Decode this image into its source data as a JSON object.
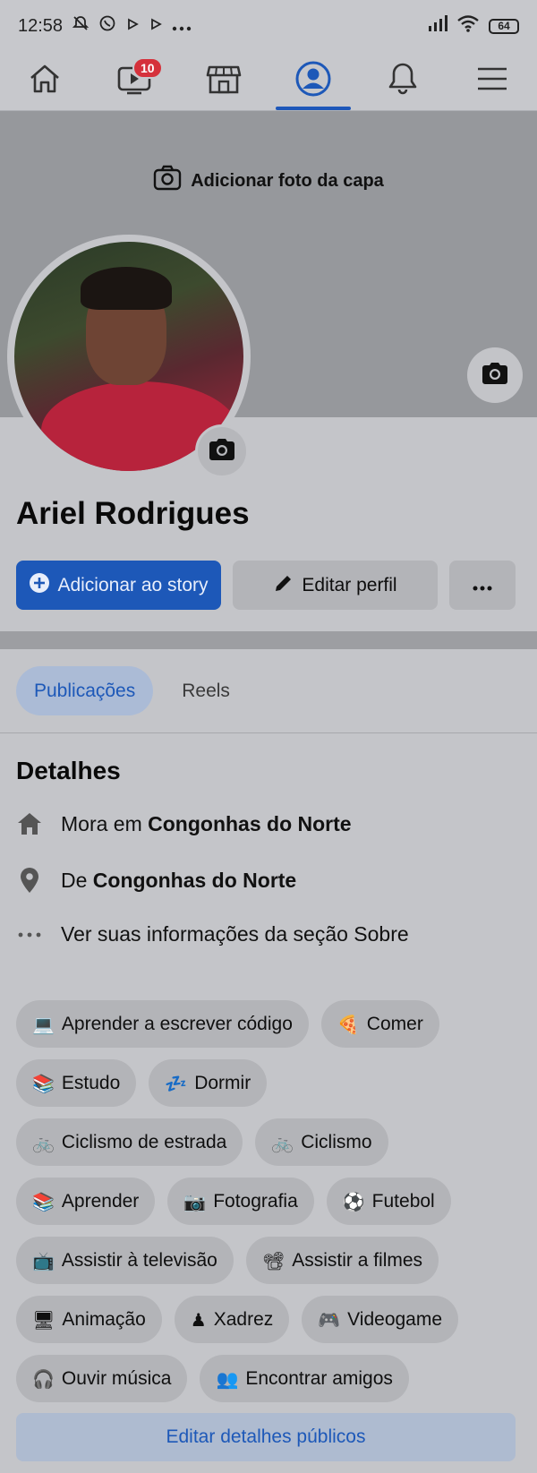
{
  "status_bar": {
    "time": "12:58",
    "battery": "64"
  },
  "nav": {
    "video_badge": "10"
  },
  "cover": {
    "add_cover_label": "Adicionar foto da capa"
  },
  "profile": {
    "name": "Ariel Rodrigues"
  },
  "actions": {
    "add_story_label": "Adicionar ao story",
    "edit_profile_label": "Editar perfil",
    "more_label": "•••"
  },
  "tabs": [
    {
      "label": "Publicações",
      "active": true
    },
    {
      "label": "Reels",
      "active": false
    }
  ],
  "details": {
    "title": "Detalhes",
    "lives_prefix": "Mora em ",
    "lives_city": "Congonhas do Norte",
    "from_prefix": "De ",
    "from_city": "Congonhas do Norte",
    "about_link": "Ver suas informações da seção Sobre"
  },
  "hobbies": [
    {
      "emoji": "💻",
      "label": "Aprender a escrever código"
    },
    {
      "emoji": "🍕",
      "label": "Comer"
    },
    {
      "emoji": "📚",
      "label": "Estudo"
    },
    {
      "emoji": "💤",
      "label": "Dormir"
    },
    {
      "emoji": "🚲",
      "label": "Ciclismo de estrada"
    },
    {
      "emoji": "🚲",
      "label": "Ciclismo"
    },
    {
      "emoji": "📚",
      "label": "Aprender"
    },
    {
      "emoji": "📷",
      "label": "Fotografia"
    },
    {
      "emoji": "⚽",
      "label": "Futebol"
    },
    {
      "emoji": "📺",
      "label": "Assistir à televisão"
    },
    {
      "emoji": "📽",
      "label": "Assistir a filmes"
    },
    {
      "emoji": "🖥",
      "label": "Animação"
    },
    {
      "emoji": "♟",
      "label": "Xadrez"
    },
    {
      "emoji": "🎮",
      "label": "Videogame"
    },
    {
      "emoji": "🎧",
      "label": "Ouvir música"
    },
    {
      "emoji": "👥",
      "label": "Encontrar amigos"
    }
  ],
  "edit_public_label": "Editar detalhes públicos",
  "colors": {
    "accent": "#1d58b8",
    "badge": "#d5313b"
  }
}
